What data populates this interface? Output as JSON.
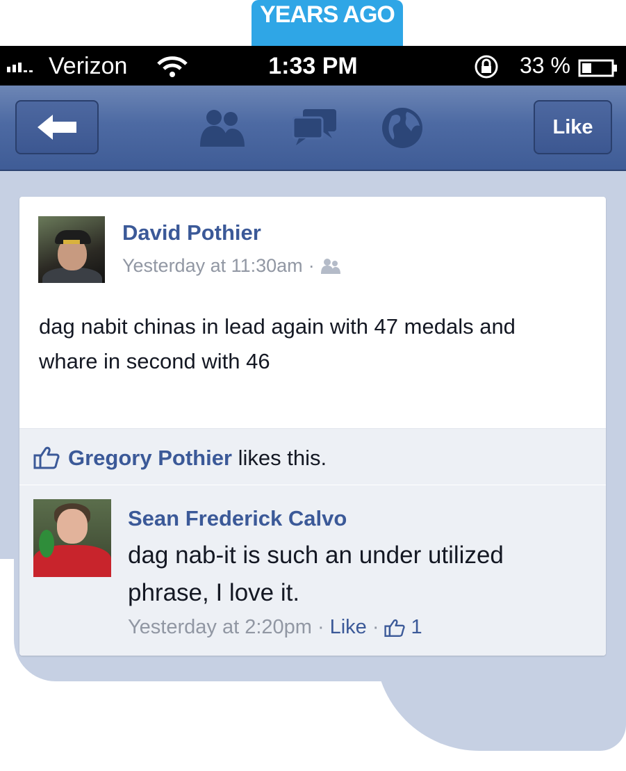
{
  "banner": {
    "text": "YEARS AGO"
  },
  "status_bar": {
    "carrier": "Verizon",
    "time": "1:33 PM",
    "battery_percent": "33 %",
    "battery_level": 0.33
  },
  "nav": {
    "like_label": "Like",
    "icons": [
      "back-arrow-icon",
      "friends-icon",
      "messages-icon",
      "globe-icon"
    ]
  },
  "post": {
    "author": "David Pothier",
    "timestamp": "Yesterday at 11:30am",
    "separator": "·",
    "text": "dag nabit chinas in lead again with 47 medals and whare in second with 46"
  },
  "likes": {
    "name": "Gregory Pothier",
    "suffix": " likes this."
  },
  "comment": {
    "author": "Sean Frederick Calvo",
    "text": "dag nab-it is such an under utilized phrase, I love it.",
    "timestamp": "Yesterday at 2:20pm",
    "separator": "·",
    "like_label": "Like",
    "like_count": "1"
  },
  "colors": {
    "facebook_blue": "#3b5998",
    "nav_bar": "#4d6aa3",
    "banner_blue": "#2fa6e6",
    "background": "#c6d0e3"
  }
}
